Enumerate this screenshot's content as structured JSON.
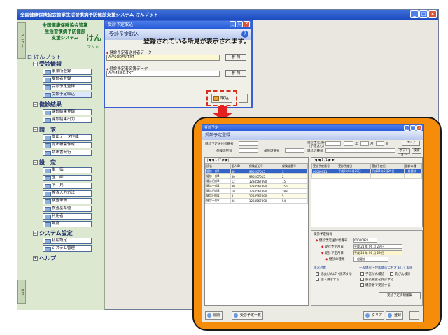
{
  "main_window": {
    "title": "全国健康保険協会管掌生活習慣病予防健診支援システム けんプット",
    "buttons": [
      "_",
      "□",
      "×"
    ]
  },
  "sidebar": {
    "logo_line1": "全国健康保険協会管掌",
    "logo_line2": "生活習慣病予防健診",
    "logo_line3": "支援システム",
    "logo_mark": "けん",
    "logo_mark2": "プット",
    "vtab_top": "メニュー",
    "vtab_bottom": "ロゴ",
    "root": "けんプット",
    "sections": [
      {
        "label": "受診情報",
        "items": [
          "事業所登録",
          "受診者登録",
          "受診予定登録",
          "受診予定取込"
        ]
      },
      {
        "label": "健診結果",
        "items": [
          "健診結果登録",
          "健診結果出力"
        ]
      },
      {
        "label": "請　求",
        "items": [
          "提出データ作成",
          "提出帳票作成",
          "請求書発行"
        ]
      },
      {
        "label": "設　定",
        "items": [
          "単　価",
          "医　師",
          "所　見",
          "検査入力方法",
          "検査単価",
          "検査基準値",
          "利用者",
          "年度"
        ]
      },
      {
        "label": "システム設定",
        "items": [
          "初期設定",
          "システム管理"
        ]
      },
      {
        "label": "ヘルプ",
        "items": []
      }
    ]
  },
  "dialog_top": {
    "title": "受診予定取込",
    "header": "受診予定取込",
    "message": "登録されている所見が表示されます。",
    "field1_label": "健診予定者送付者データ",
    "field1_value": "A:¥SODFU.TXT",
    "field2_label": "健診予定者名簿データ",
    "field2_value": "A:¥MEIBO.TXT",
    "ref_label": "参 照",
    "import_label": "取込"
  },
  "dialog_bottom": {
    "title": "受診予定",
    "header": "受診予定登録",
    "search": {
      "label_id": "健診予定送付者番号",
      "label_sign": "保険証記号",
      "label_num": "保険証番号",
      "label_date": "受診予定月日",
      "label_date_sub": "（予定含む）",
      "label_kind": "健診の種類",
      "year": "年",
      "month": "月",
      "day": "日",
      "clear": "クリア",
      "option": "オプション",
      "search_btn": "検索"
    },
    "left_grid": {
      "nav": "|◀  ◀  1 /7  ▶  ▶|",
      "columns": [
        "氏名",
        "個人ID",
        "保険証記号",
        "保険証番号"
      ],
      "rows": [
        [
          "健診一郎2",
          "40",
          "990207015",
          "3"
        ],
        [
          "健診一郎4",
          "50",
          "990207015",
          "2"
        ],
        [
          "健診日郎3",
          "12",
          "1234567890",
          "15"
        ],
        [
          "健診一郎1",
          "30",
          "1234567890",
          "150"
        ],
        [
          "健診日郎3",
          "10",
          "1234567890",
          "289"
        ],
        [
          "健診日郎1",
          "3",
          "1234567890",
          "5"
        ],
        [
          "健診一郎2",
          "36",
          "1234567890",
          "54"
        ]
      ]
    },
    "right_grid": {
      "nav": "|◀  ◀  1 /1  ▶  ▶|",
      "columns": [
        "受診予定番号",
        "受診予定日",
        "受診予定日",
        "健診の種"
      ],
      "rows": [
        [
          "00000921",
          "平成21年6月29日",
          "平成21年6月29日",
          "一般健診"
        ]
      ]
    },
    "detail": {
      "title": "受診予定情報",
      "id_label": "健診予定送付者番号",
      "id_value": "00000921",
      "date_label": "受診予定月日",
      "date_value": "平成 21 年 06 月 29 日",
      "date2_label": "受診予定月日",
      "date2_value": "平成 21 年 06 月 29 日",
      "kind_label": "健診の種類",
      "kind_value": "一般健診",
      "claim_label": "請求対象",
      "claim_opt1": "協会けんぽへ請求する",
      "claim_opt2": "個人請求する",
      "extra_label": "一般健診・付加健診におきまして実施",
      "extra1": "子宮がん検診",
      "extra2": "乳がん検診",
      "extra3": "肝炎検査を受診する",
      "extra4": "健診者で受診する",
      "register_label": "受診予定情報編集"
    },
    "bottom_buttons": {
      "delete": "削除",
      "list": "受診予定一覧",
      "clear": "クリア",
      "register": "登録"
    }
  },
  "colors": {
    "titlebar": "#2558d6",
    "frame": "#f58c0a",
    "arrow": "#e52020",
    "sidebar_bg": "#dde8d1"
  }
}
